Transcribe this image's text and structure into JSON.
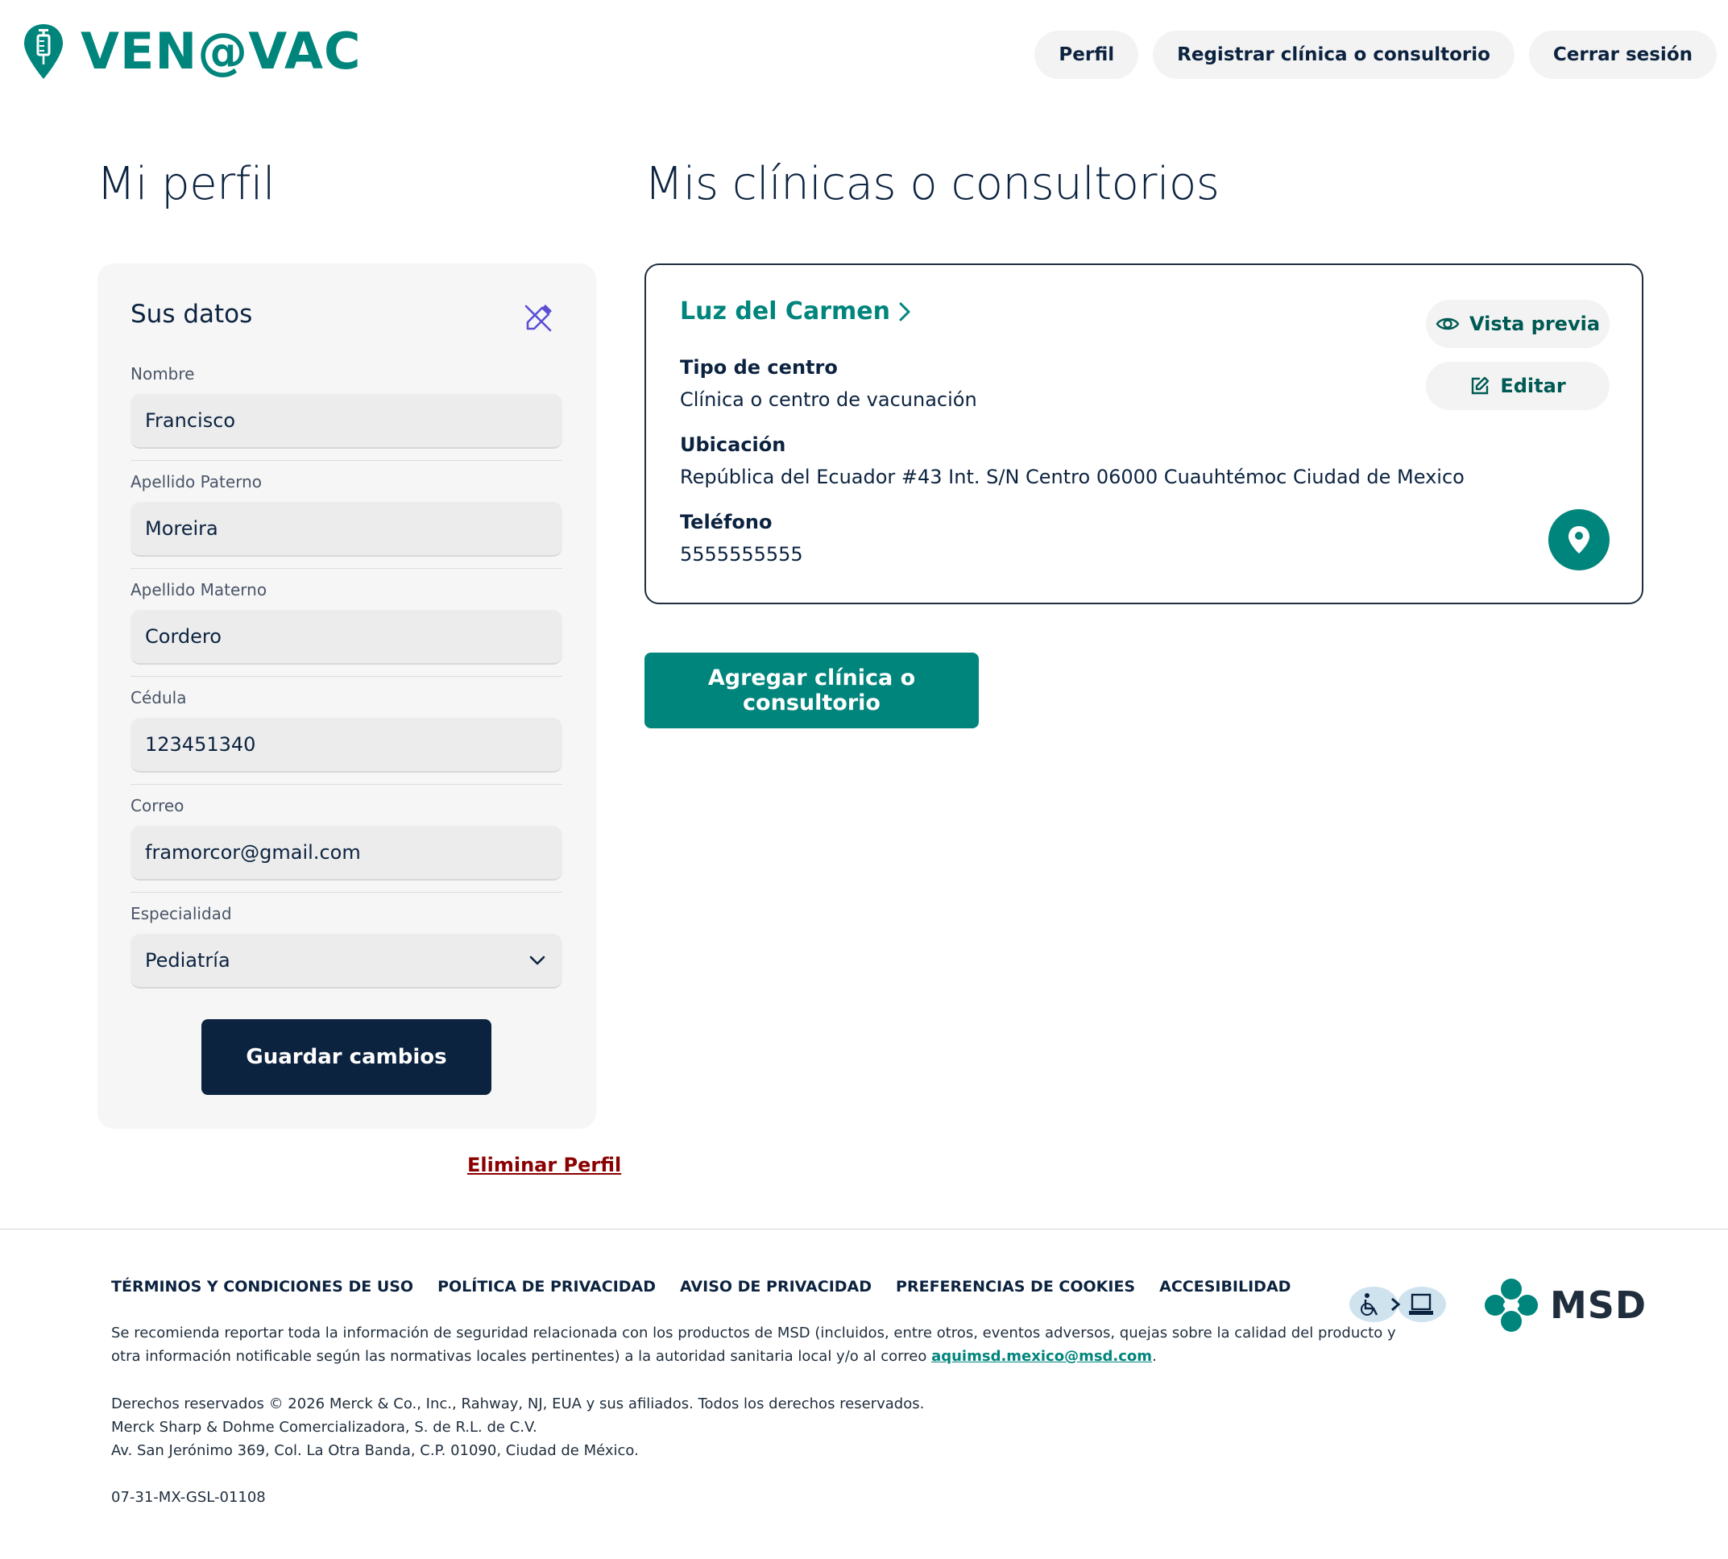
{
  "brand": {
    "logo_text": "VEN@VAC",
    "accent_color": "#00857c",
    "navy_color": "#0c2340"
  },
  "nav": {
    "profile": "Perfil",
    "register": "Registrar clínica o consultorio",
    "logout": "Cerrar sesión"
  },
  "profile": {
    "page_title": "Mi perfil",
    "card_title": "Sus datos",
    "edit_icon": "pencil-off-icon",
    "fields": [
      {
        "label": "Nombre",
        "value": "Francisco"
      },
      {
        "label": "Apellido Paterno",
        "value": "Moreira"
      },
      {
        "label": "Apellido Materno",
        "value": "Cordero"
      },
      {
        "label": "Cédula",
        "value": "123451340"
      },
      {
        "label": "Correo",
        "value": "framorcor@gmail.com"
      }
    ],
    "specialty": {
      "label": "Especialidad",
      "value": "Pediatría"
    },
    "save_label": "Guardar cambios",
    "delete_label": "Eliminar Perfil"
  },
  "clinics": {
    "page_title": "Mis clínicas o consultorios",
    "items": [
      {
        "name": "Luz del Carmen",
        "type_label": "Tipo de centro",
        "type_value": "Clínica o centro de vacunación",
        "location_label": "Ubicación",
        "location_value": "República del Ecuador #43 Int. S/N Centro 06000 Cuauhtémoc Ciudad de Mexico",
        "phone_label": "Teléfono",
        "phone_value": "5555555555",
        "preview_label": "Vista previa",
        "edit_label": "Editar"
      }
    ],
    "add_label": "Agregar clínica o consultorio"
  },
  "footer": {
    "links": [
      "TÉRMINOS Y CONDICIONES DE USO",
      "POLÍTICA DE PRIVACIDAD",
      "AVISO DE PRIVACIDAD",
      "PREFERENCIAS DE COOKIES",
      "ACCESIBILIDAD"
    ],
    "safety_text_1": "Se recomienda reportar toda la información de seguridad relacionada con los productos de MSD (incluidos, entre otros, eventos adversos, quejas sobre la calidad del producto y",
    "safety_text_2": "otra información notificable según las normativas locales pertinentes) a la autoridad sanitaria local y/o al correo ",
    "safety_email": "aquimsd.mexico@msd.com",
    "safety_end": ".",
    "rights_1": "Derechos reservados © 2026 Merck & Co., Inc., Rahway, NJ, EUA y sus afiliados. Todos los derechos reservados.",
    "rights_2": "Merck Sharp & Dohme Comercializadora, S. de R.L. de C.V.",
    "rights_3": "Av. San Jerónimo 369, Col. La Otra Banda, C.P. 01090, Ciudad de México.",
    "code": "07-31-MX-GSL-01108",
    "msd_logo_text": "MSD"
  }
}
